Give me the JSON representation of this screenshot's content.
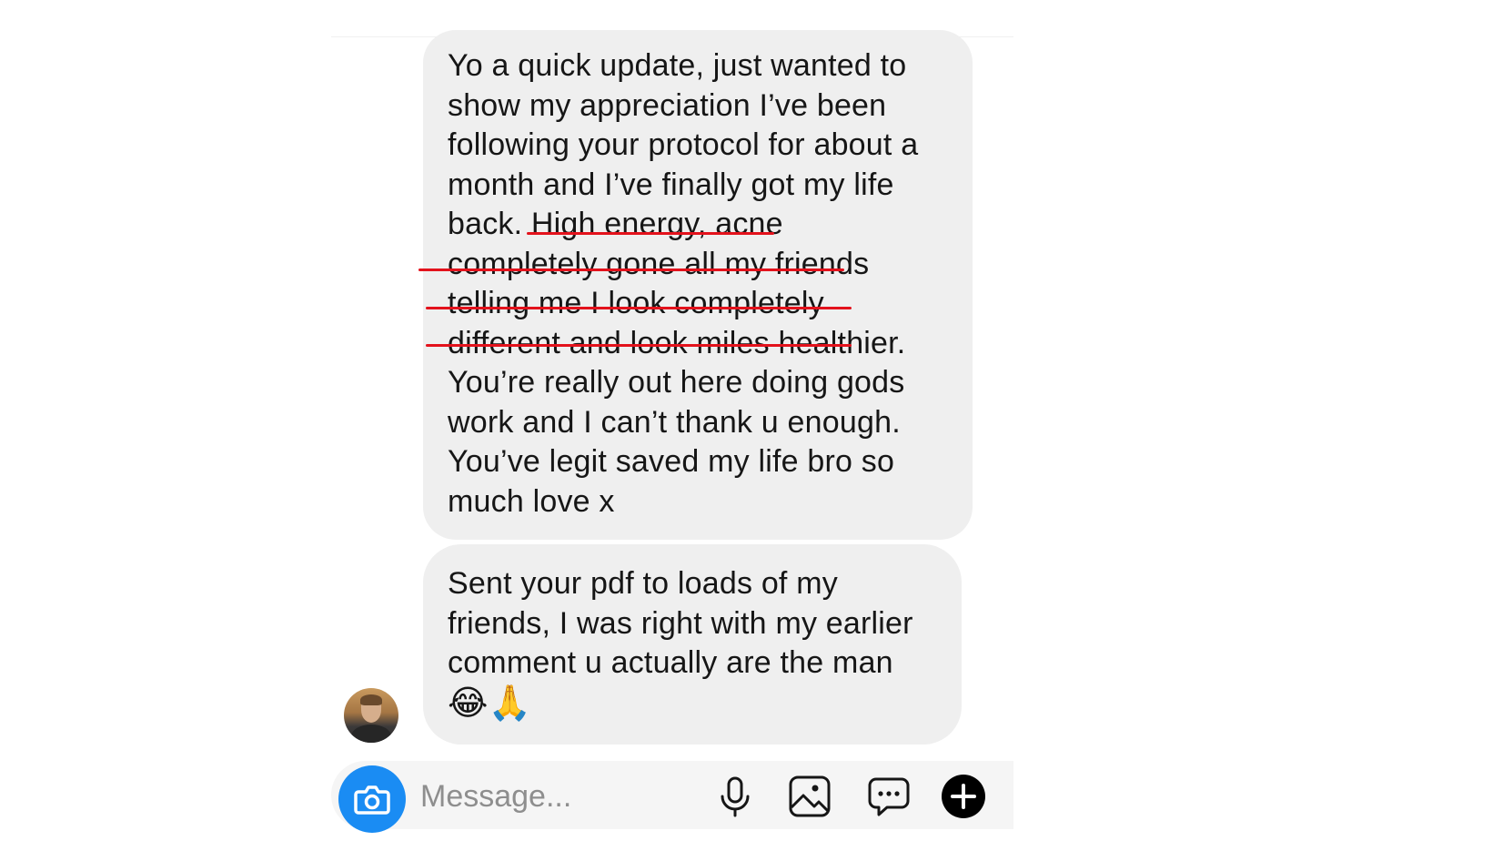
{
  "messages": [
    {
      "lines": [
        "Yo a quick update, just wanted to",
        "show my appreciation I’ve been",
        "following your protocol for about a",
        "month and I’ve finally got my life",
        "back. High energy, acne",
        "completely gone all my friends",
        "telling me I look completely",
        "different and look miles healthier.",
        "You’re really out here doing gods",
        "work and I can’t thank u enough.",
        "You’ve legit saved my life bro so",
        "much love x"
      ]
    },
    {
      "lines": [
        "Sent your pdf to loads of my",
        "friends, I was right with my earlier",
        "comment u actually are the man",
        "😂🙏"
      ]
    }
  ],
  "composer": {
    "placeholder": "Message...",
    "icons": [
      "camera-icon",
      "microphone-icon",
      "gallery-icon",
      "sticker-chat-icon",
      "plus-icon"
    ]
  },
  "colors": {
    "bubble": "#efefef",
    "underline": "#e3121c",
    "camera_button": "#1a8cf3",
    "composer_bg": "#f5f5f5"
  }
}
